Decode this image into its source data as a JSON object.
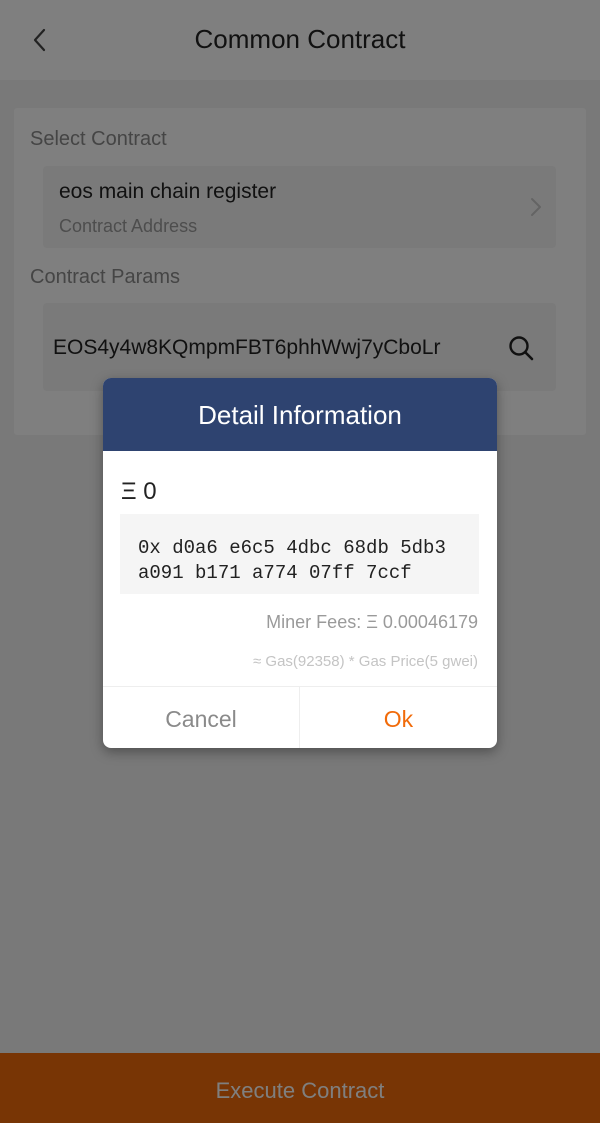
{
  "header": {
    "title": "Common Contract"
  },
  "select_contract": {
    "label": "Select Contract",
    "name": "eos main chain register",
    "address_placeholder": "Contract Address"
  },
  "contract_params": {
    "label": "Contract Params",
    "value": "EOS4y4w8KQmpmFBT6phhWwj7yCboLr"
  },
  "footer": {
    "execute_label": "Execute Contract"
  },
  "dialog": {
    "title": "Detail Information",
    "amount": "Ξ 0",
    "hash_line1": "0x d0a6 e6c5 4dbc 68db 5db3",
    "hash_line2": "a091 b171 a774 07ff 7ccf",
    "miner_fees": "Miner Fees: Ξ 0.00046179",
    "gas_detail": "≈ Gas(92358) * Gas Price(5 gwei)",
    "cancel_label": "Cancel",
    "ok_label": "Ok"
  },
  "colors": {
    "accent": "#f16b0a",
    "dialog_header": "#2e4370",
    "overlay": "rgba(0,0,0,0.5)"
  },
  "icons": [
    "back-icon",
    "chevron-right-icon",
    "search-icon"
  ]
}
